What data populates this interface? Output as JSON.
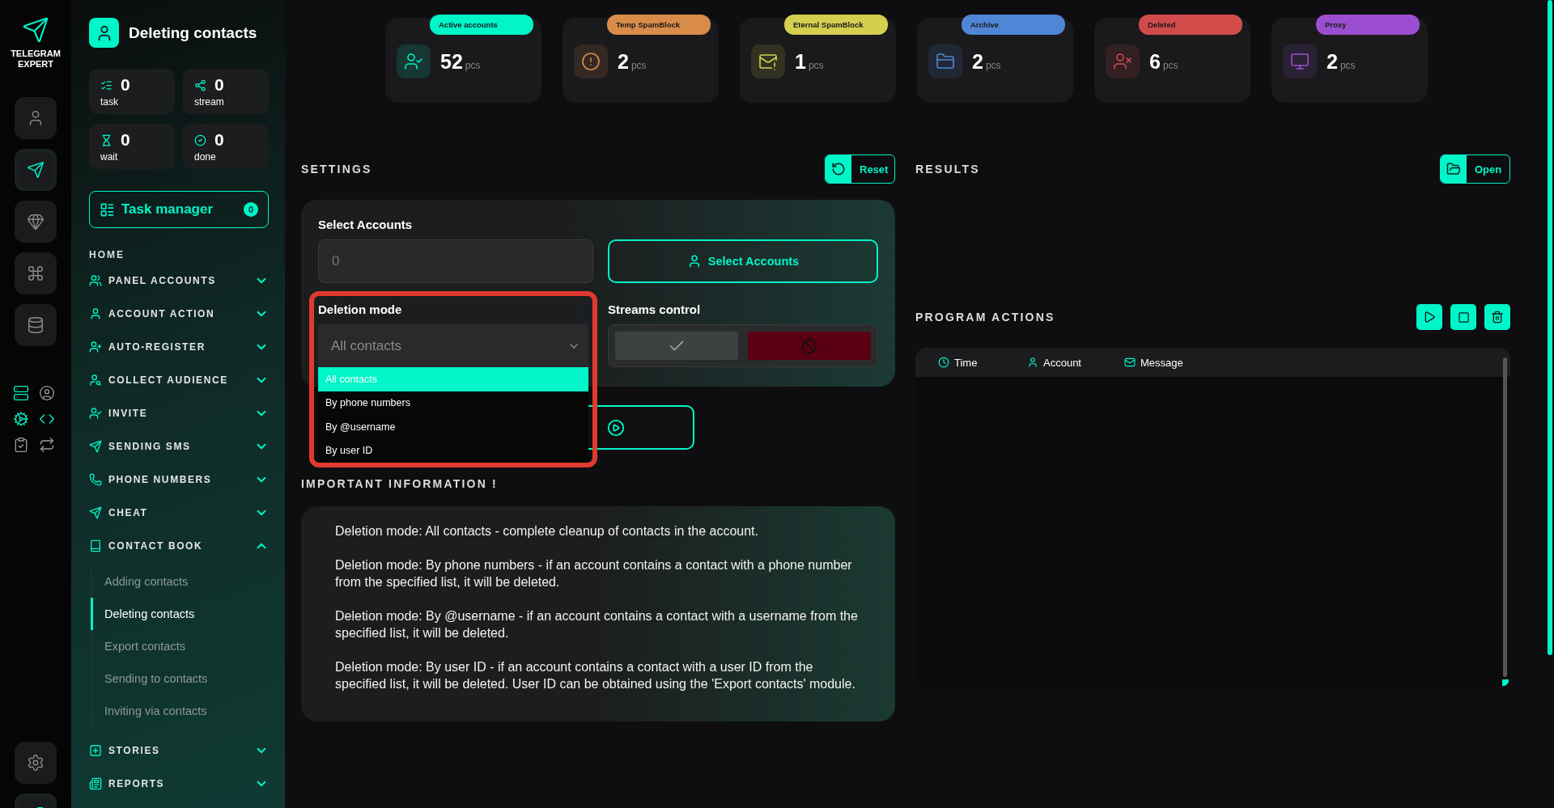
{
  "rail": {
    "logo": "TELEGRAM EXPERT",
    "items": [
      {
        "selected": false
      },
      {
        "selected": true
      },
      {
        "selected": false
      },
      {
        "selected": false
      },
      {
        "selected": false
      }
    ],
    "tools": [
      {
        "active": true
      },
      {
        "active": false
      },
      {
        "active": true
      },
      {
        "active": true
      },
      {
        "active": false
      },
      {
        "active": false
      }
    ],
    "bottom": [
      {
        "active": false
      },
      {
        "active": true
      }
    ]
  },
  "sidebar": {
    "title": "Deleting contacts",
    "counters": [
      {
        "value": "0",
        "label": "task"
      },
      {
        "value": "0",
        "label": "stream"
      },
      {
        "value": "0",
        "label": "wait"
      },
      {
        "value": "0",
        "label": "done"
      }
    ],
    "task_manager": {
      "label": "Task manager",
      "count": "0"
    },
    "home": "HOME",
    "nav": [
      {
        "label": "PANEL ACCOUNTS",
        "expanded": false
      },
      {
        "label": "ACCOUNT ACTION",
        "expanded": false
      },
      {
        "label": "AUTO-REGISTER",
        "expanded": false
      },
      {
        "label": "COLLECT AUDIENCE",
        "expanded": false
      },
      {
        "label": "INVITE",
        "expanded": false
      },
      {
        "label": "SENDING SMS",
        "expanded": false
      },
      {
        "label": "PHONE NUMBERS",
        "expanded": false
      },
      {
        "label": "CHEAT",
        "expanded": false
      },
      {
        "label": "CONTACT BOOK",
        "expanded": true,
        "children": [
          {
            "label": "Adding contacts",
            "selected": false
          },
          {
            "label": "Deleting contacts",
            "selected": true
          },
          {
            "label": "Export contacts",
            "selected": false
          },
          {
            "label": "Sending to contacts",
            "selected": false
          },
          {
            "label": "Inviting via contacts",
            "selected": false
          }
        ]
      },
      {
        "label": "STORIES",
        "expanded": false
      },
      {
        "label": "REPORTS",
        "expanded": false
      }
    ]
  },
  "stat_cards": [
    {
      "tag": "Active accounts",
      "value": "52",
      "unit": "pcs",
      "color": "#00f5c8"
    },
    {
      "tag": "Temp SpamBlock",
      "value": "2",
      "unit": "pcs",
      "color": "#d98c4a"
    },
    {
      "tag": "Eternal SpamBlock",
      "value": "1",
      "unit": "pcs",
      "color": "#d4cf4e"
    },
    {
      "tag": "Archive",
      "value": "2",
      "unit": "pcs",
      "color": "#4f86d6"
    },
    {
      "tag": "Deleted",
      "value": "6",
      "unit": "pcs",
      "color": "#d24b4b"
    },
    {
      "tag": "Proxy",
      "value": "2",
      "unit": "pcs",
      "color": "#9b4fd0"
    }
  ],
  "settings": {
    "title": "SETTINGS",
    "reset": "Reset",
    "accounts": {
      "label": "Select Accounts",
      "placeholder": "0",
      "button": "Select Accounts"
    },
    "deletion_mode": {
      "label": "Deletion mode",
      "value": "All contacts",
      "expanded": true,
      "options": [
        {
          "label": "All contacts",
          "selected": true
        },
        {
          "label": "By phone numbers",
          "selected": false
        },
        {
          "label": "By @username",
          "selected": false
        },
        {
          "label": "By user ID",
          "selected": false
        }
      ]
    },
    "streams": {
      "label": "Streams control"
    }
  },
  "info": {
    "title": "IMPORTANT INFORMATION !",
    "paragraphs": [
      "Deletion mode: All contacts - complete cleanup of contacts in the account.",
      "Deletion mode: By phone numbers - if an account contains a contact with a phone number from the specified list, it will be deleted.",
      "Deletion mode: By @username - if an account contains a contact with a username from the specified list, it will be deleted.",
      "Deletion mode: By user ID - if an account contains a contact with a user ID from the specified list, it will be deleted. User ID can be obtained using the 'Export contacts' module."
    ]
  },
  "results": {
    "title": "RESULTS",
    "open": "Open"
  },
  "program_actions": {
    "title": "PROGRAM ACTIONS",
    "columns": [
      "Time",
      "Account",
      "Message"
    ]
  }
}
